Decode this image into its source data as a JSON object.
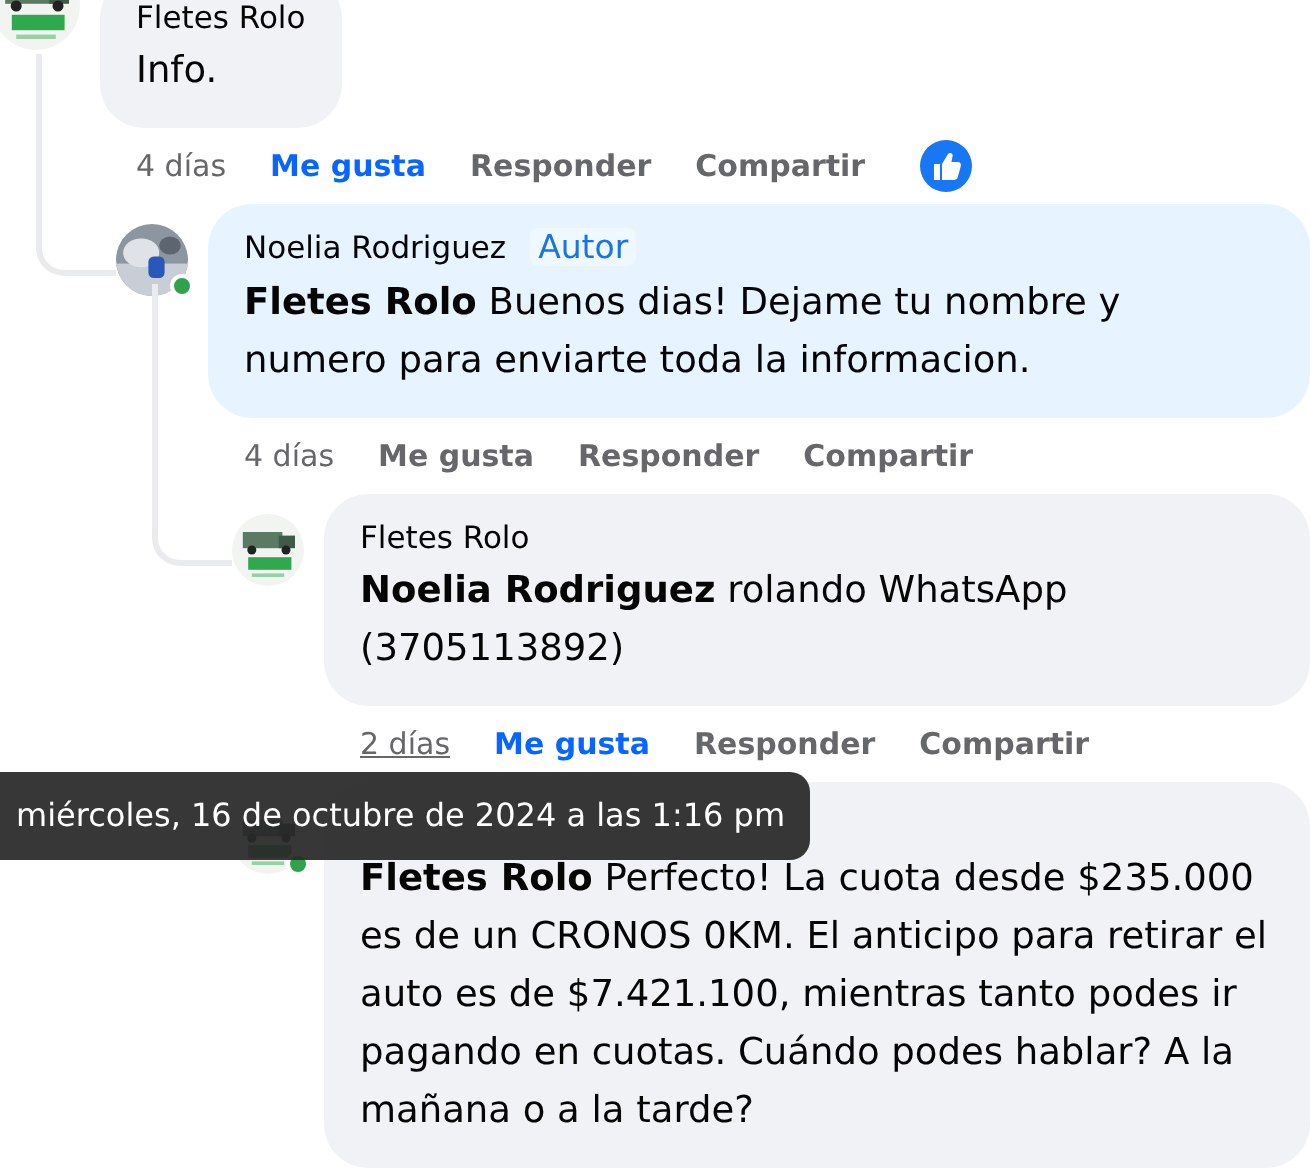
{
  "comments": [
    {
      "author": "Fletes Rolo",
      "text": "Info.",
      "time": "4 días",
      "time_hovered": false,
      "liked": true,
      "like_label": "Me gusta",
      "reply_label": "Responder",
      "share_label": "Compartir",
      "reaction": true,
      "children": [
        {
          "author": "Noelia Rodriguez",
          "badge": "Autor",
          "online": true,
          "text": "**Fletes Rolo** Buenos dias! Dejame tu nombre y numero para enviarte toda la informacion.",
          "time": "4 días",
          "time_hovered": false,
          "liked": false,
          "like_label": "Me gusta",
          "reply_label": "Responder",
          "share_label": "Compartir",
          "children": [
            {
              "author": "Fletes Rolo",
              "text": "**Noelia Rodriguez** rolando WhatsApp (3705113892)",
              "time": "2 días",
              "time_hovered": true,
              "liked": true,
              "like_label": "Me gusta",
              "reply_label": "Responder",
              "share_label": "Compartir"
            },
            {
              "online": true,
              "text": "**Fletes Rolo** Perfecto! La cuota desde $235.000 es de un CRONOS 0KM. El anticipo para retirar el auto es de $7.421.100, mientras tanto podes ir pagando en cuotas. Cuándo podes hablar? A la mañana o a la tarde?"
            }
          ]
        }
      ]
    }
  ],
  "tooltip": {
    "text": "miércoles, 16 de octubre de 2024 a las 1:16 pm"
  }
}
